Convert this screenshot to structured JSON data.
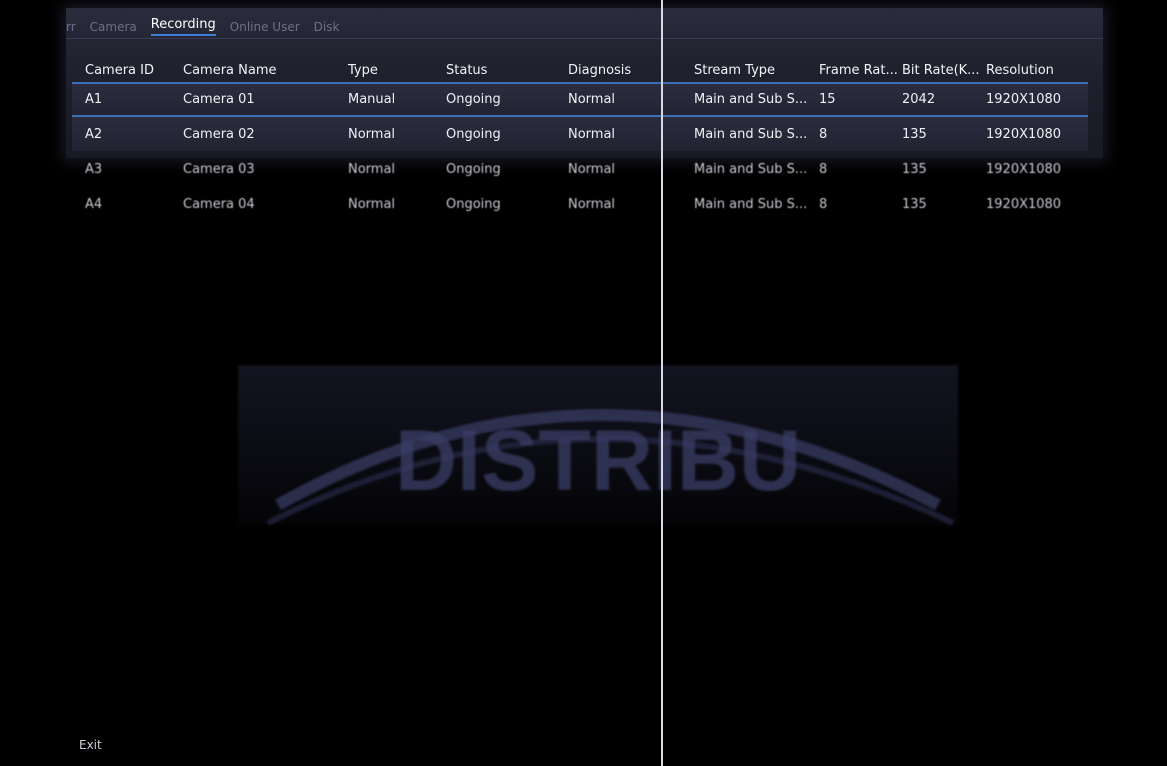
{
  "tabs": {
    "cut": "rr",
    "camera": "Camera",
    "recording": "Recording",
    "online_user": "Online User",
    "disk": "Disk"
  },
  "table": {
    "headers": {
      "camera_id": "Camera ID",
      "camera_name": "Camera Name",
      "type": "Type",
      "status": "Status",
      "diagnosis": "Diagnosis",
      "stream_type": "Stream Type",
      "frame_rate": "Frame Rat...",
      "bit_rate": "Bit Rate(K...",
      "resolution": "Resolution"
    },
    "rows": [
      {
        "id": "A1",
        "name": "Camera 01",
        "type": "Manual",
        "status": "Ongoing",
        "diagnosis": "Normal",
        "stream": "Main and Sub S...",
        "frame": "15",
        "bit": "2042",
        "res": "1920X1080"
      },
      {
        "id": "A2",
        "name": "Camera 02",
        "type": "Normal",
        "status": "Ongoing",
        "diagnosis": "Normal",
        "stream": "Main and Sub S...",
        "frame": "8",
        "bit": "135",
        "res": "1920X1080"
      },
      {
        "id": "A3",
        "name": "Camera 03",
        "type": "Normal",
        "status": "Ongoing",
        "diagnosis": "Normal",
        "stream": "Main and Sub S...",
        "frame": "8",
        "bit": "135",
        "res": "1920X1080"
      },
      {
        "id": "A4",
        "name": "Camera 04",
        "type": "Normal",
        "status": "Ongoing",
        "diagnosis": "Normal",
        "stream": "Main and Sub S...",
        "frame": "8",
        "bit": "135",
        "res": "1920X1080"
      }
    ]
  },
  "watermark": {
    "text": "DISTRIBU"
  },
  "footer": {
    "exit_label": "Exit"
  },
  "colors": {
    "accent": "#3d6fb6",
    "tab_underline": "#3f7fd6",
    "background": "#000000"
  }
}
